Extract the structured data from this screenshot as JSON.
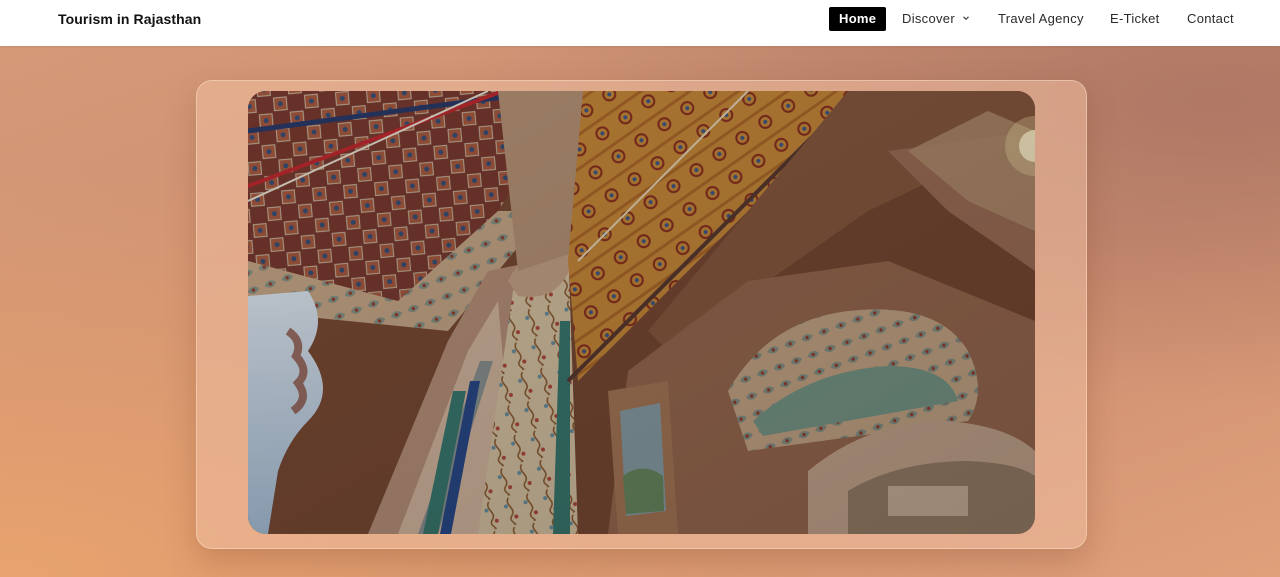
{
  "header": {
    "brand": "Tourism in Rajasthan",
    "nav": [
      {
        "label": "Home",
        "active": true
      },
      {
        "label": "Discover",
        "has_dropdown": true
      },
      {
        "label": "Travel Agency"
      },
      {
        "label": "E-Ticket"
      },
      {
        "label": "Contact"
      }
    ]
  },
  "hero": {
    "media_type": "video",
    "subject": "painted palace ceiling interior"
  },
  "icons": {
    "discover_dropdown": "chevron-down-icon"
  },
  "colors": {
    "active_nav_bg": "#000000",
    "active_nav_text": "#ffffff",
    "hero_gradient_start": "#d49a78",
    "hero_gradient_end": "#e0a07a"
  }
}
